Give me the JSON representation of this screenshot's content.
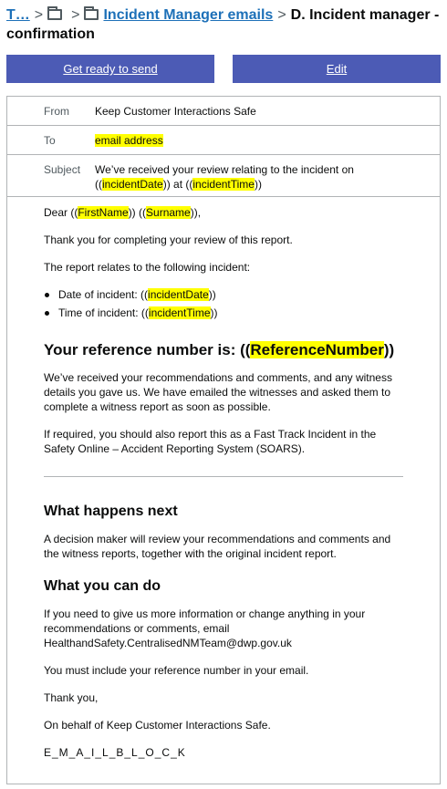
{
  "breadcrumb": {
    "root": "T…",
    "parent": "Incident Manager emails",
    "current_line1": "D. Incident manager -",
    "current_line2": "confirmation"
  },
  "actions": {
    "send_label": "Get ready to send",
    "edit_label": "Edit"
  },
  "meta": {
    "from_label": "From",
    "from_value": "Keep Customer Interactions Safe",
    "to_label": "To",
    "to_value": "email address",
    "subject_label": "Subject",
    "subject_line1": "We’ve received your review relating to the incident on",
    "subject_open1": "((",
    "subject_field1": "incidentDate",
    "subject_mid": ")) at ((",
    "subject_field2": "incidentTime",
    "subject_close": "))"
  },
  "body": {
    "greeting_prefix": "Dear ((",
    "greeting_field1": "FirstName",
    "greeting_mid": ")) ((",
    "greeting_field2": "Surname",
    "greeting_suffix": ")),",
    "thanks": "Thank you for completing your review of this report.",
    "relates": "The report relates to the following incident:",
    "bullets": [
      {
        "prefix": "Date of incident: ((",
        "field": "incidentDate",
        "suffix": "))"
      },
      {
        "prefix": "Time of incident: ((",
        "field": "incidentTime",
        "suffix": "))"
      }
    ],
    "ref_heading_prefix": "Your reference number is: ((",
    "ref_heading_field": "ReferenceNumber",
    "ref_heading_suffix": "))",
    "received_line1": "We’ve received your recommendations and comments, and any witness",
    "received_line2": "details you gave us. We have emailed the witnesses and asked them to",
    "received_line3": "complete a witness report as soon as possible.",
    "required_line1": "If required, you should also report this as a Fast Track Incident in the",
    "required_line2": "Safety Online – Accident Reporting System (SOARS).",
    "next_heading": "What happens next",
    "next_line1": "A decision maker will review your recommendations and comments and",
    "next_line2": "the witness reports, together with the original incident report.",
    "do_heading": "What you can do",
    "do_line1": "If you need to give us more information or change anything in your",
    "do_line2": "recommendations or comments, email",
    "do_line3": "HealthandSafety.CentralisedNMTeam@dwp.gov.uk",
    "must_include": "You must include your reference number in your email.",
    "sign_thanks": "Thank you,",
    "sign_behalf": "On behalf of Keep Customer Interactions Safe.",
    "email_block": "E_M_A_I_L_B_L_O_C_K"
  },
  "colors": {
    "link": "#1d70b8",
    "button": "#4c5bb5",
    "highlight": "#ffff00",
    "border": "#b1b4b6"
  }
}
